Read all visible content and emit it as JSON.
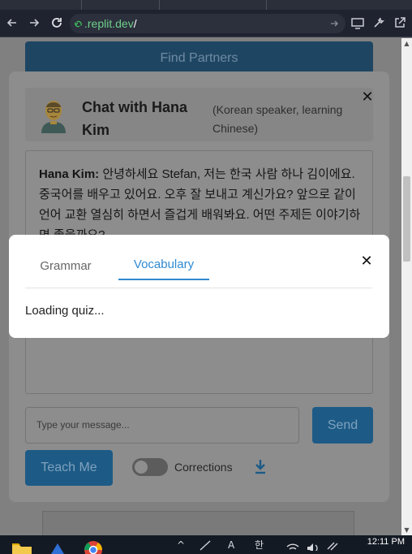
{
  "browser": {
    "url_domain": ".replit.dev",
    "url_path": "/",
    "back_icon": "back-arrow-icon",
    "forward_icon": "forward-arrow-icon",
    "reload_icon": "reload-icon"
  },
  "page": {
    "find_partners_label": "Find Partners"
  },
  "chat": {
    "title": "Chat with Hana Kim",
    "subtitle": "(Korean speaker, learning Chinese)",
    "message_sender": "Hana Kim:",
    "message_text": "안녕하세요 Stefan, 저는 한국 사람 하나 김이에요. 중국어를 배우고 있어요. 오후 잘 보내고 계신가요? 앞으로 같이 언어 교환 열심히 하면서 즐겁게 배워봐요. 어떤 주제든 이야기하면 좋을까요?",
    "input_placeholder": "Type your message...",
    "send_label": "Send",
    "teach_label": "Teach Me",
    "corrections_label": "Corrections",
    "corrections_enabled": false
  },
  "quiz": {
    "tabs": [
      {
        "label": "Grammar",
        "active": false
      },
      {
        "label": "Vocabulary",
        "active": true
      }
    ],
    "status": "Loading quiz..."
  },
  "taskbar": {
    "time": "12:11 PM",
    "ime_label": "한"
  },
  "colors": {
    "accent": "#2f8ad1",
    "button_dimmed": "#1d5b86",
    "overlay": "#808080",
    "url_green": "#6fd08c"
  }
}
